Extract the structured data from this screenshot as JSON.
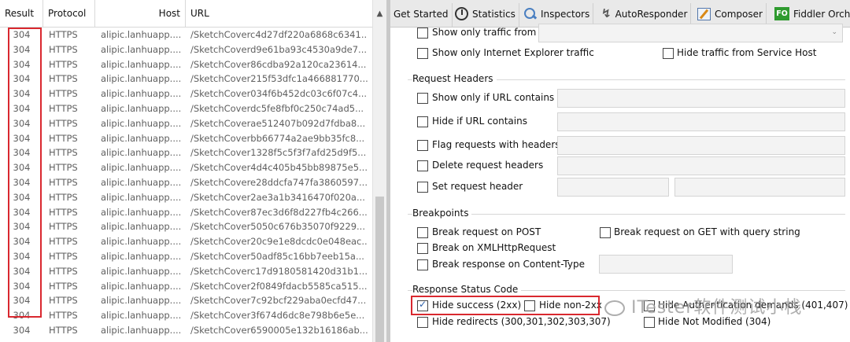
{
  "sessions": {
    "columns": {
      "result": "Result",
      "protocol": "Protocol",
      "host": "Host",
      "url": "URL"
    },
    "scroll_up_icon": "up-arrow",
    "rows": [
      {
        "result": "304",
        "protocol": "HTTPS",
        "host": "alipic.lanhuapp....",
        "url": "/SketchCoverc4d27df220a6868c6341..."
      },
      {
        "result": "304",
        "protocol": "HTTPS",
        "host": "alipic.lanhuapp....",
        "url": "/SketchCoverd9e61ba93c4530a9de7..."
      },
      {
        "result": "304",
        "protocol": "HTTPS",
        "host": "alipic.lanhuapp....",
        "url": "/SketchCover86cdba92a120ca23614..."
      },
      {
        "result": "304",
        "protocol": "HTTPS",
        "host": "alipic.lanhuapp....",
        "url": "/SketchCover215f53dfc1a466881770..."
      },
      {
        "result": "304",
        "protocol": "HTTPS",
        "host": "alipic.lanhuapp....",
        "url": "/SketchCover034f6b452dc03c6f07c4..."
      },
      {
        "result": "304",
        "protocol": "HTTPS",
        "host": "alipic.lanhuapp....",
        "url": "/SketchCoverdc5fe8fbf0c250c74ad5..."
      },
      {
        "result": "304",
        "protocol": "HTTPS",
        "host": "alipic.lanhuapp....",
        "url": "/SketchCoverae512407b092d7fdba8..."
      },
      {
        "result": "304",
        "protocol": "HTTPS",
        "host": "alipic.lanhuapp....",
        "url": "/SketchCoverbb66774a2ae9bb35fc8..."
      },
      {
        "result": "304",
        "protocol": "HTTPS",
        "host": "alipic.lanhuapp....",
        "url": "/SketchCover1328f5c5f3f7afd25d9f5..."
      },
      {
        "result": "304",
        "protocol": "HTTPS",
        "host": "alipic.lanhuapp....",
        "url": "/SketchCover4d4c405b45bb89875e5..."
      },
      {
        "result": "304",
        "protocol": "HTTPS",
        "host": "alipic.lanhuapp....",
        "url": "/SketchCovere28ddcfa747fa3860597..."
      },
      {
        "result": "304",
        "protocol": "HTTPS",
        "host": "alipic.lanhuapp....",
        "url": "/SketchCover2ae3a1b3416470f020a..."
      },
      {
        "result": "304",
        "protocol": "HTTPS",
        "host": "alipic.lanhuapp....",
        "url": "/SketchCover87ec3d6f8d227fb4c266..."
      },
      {
        "result": "304",
        "protocol": "HTTPS",
        "host": "alipic.lanhuapp....",
        "url": "/SketchCover5050c676b35070f9229..."
      },
      {
        "result": "304",
        "protocol": "HTTPS",
        "host": "alipic.lanhuapp....",
        "url": "/SketchCover20c9e1e8dcdc0e048eac..."
      },
      {
        "result": "304",
        "protocol": "HTTPS",
        "host": "alipic.lanhuapp....",
        "url": "/SketchCover50adf85c16bb7eeb15a..."
      },
      {
        "result": "304",
        "protocol": "HTTPS",
        "host": "alipic.lanhuapp....",
        "url": "/SketchCoverc17d9180581420d31b1..."
      },
      {
        "result": "304",
        "protocol": "HTTPS",
        "host": "alipic.lanhuapp....",
        "url": "/SketchCover2f0849fdacb5585ca515..."
      },
      {
        "result": "304",
        "protocol": "HTTPS",
        "host": "alipic.lanhuapp....",
        "url": "/SketchCover7c92bcf229aba0ecfd47..."
      },
      {
        "result": "304",
        "protocol": "HTTPS",
        "host": "alipic.lanhuapp....",
        "url": "/SketchCover3f674d6dc8e798b6e5e..."
      },
      {
        "result": "304",
        "protocol": "HTTPS",
        "host": "alipic.lanhuapp....",
        "url": "/SketchCover6590005e132b16186ab..."
      }
    ]
  },
  "tabs": [
    {
      "label": "Get Started",
      "icon": ""
    },
    {
      "label": "Statistics",
      "icon": "stopwatch-icon"
    },
    {
      "label": "Inspectors",
      "icon": "magnifier-icon"
    },
    {
      "label": "AutoResponder",
      "icon": "lightning-icon"
    },
    {
      "label": "Composer",
      "icon": "pencil-icon"
    },
    {
      "label": "Fiddler Orche",
      "icon": "fo-icon",
      "icon_text": "FO"
    }
  ],
  "filters": {
    "traffic": {
      "show_only_from": {
        "label": "Show only traffic from",
        "checked": false,
        "value": ""
      },
      "show_only_ie": {
        "label": "Show only Internet Explorer traffic",
        "checked": false
      },
      "hide_service_host": {
        "label": "Hide traffic from Service Host",
        "checked": false
      }
    },
    "request_headers": {
      "title": "Request Headers",
      "show_if_url": {
        "label": "Show only if URL contains",
        "checked": false,
        "value": ""
      },
      "hide_if_url": {
        "label": "Hide if URL contains",
        "checked": false,
        "value": ""
      },
      "flag_with_headers": {
        "label": "Flag requests with headers",
        "checked": false,
        "value": ""
      },
      "delete_headers": {
        "label": "Delete request headers",
        "checked": false,
        "value": ""
      },
      "set_header": {
        "label": "Set request header",
        "checked": false,
        "name": "",
        "value": ""
      }
    },
    "breakpoints": {
      "title": "Breakpoints",
      "break_post": {
        "label": "Break request on POST",
        "checked": false
      },
      "break_get_qs": {
        "label": "Break request on GET with query string",
        "checked": false
      },
      "break_xhr": {
        "label": "Break on XMLHttpRequest",
        "checked": false
      },
      "break_content_type": {
        "label": "Break response on Content-Type",
        "checked": false,
        "value": ""
      }
    },
    "response_status": {
      "title": "Response Status Code",
      "hide_success": {
        "label": "Hide success (2xx)",
        "checked": true
      },
      "hide_non2xx": {
        "label": "Hide non-2xx",
        "checked": false
      },
      "hide_auth": {
        "label": "Hide Authentication demands (401,407)",
        "checked": false
      },
      "hide_redirects": {
        "label": "Hide redirects (300,301,302,303,307)",
        "checked": false
      },
      "hide_not_modified": {
        "label": "Hide Not Modified (304)",
        "checked": false
      }
    }
  },
  "watermark": "ITester软件测试小栈",
  "colors": {
    "highlight": "#d9282f",
    "fo_icon": "#2f9b2f"
  }
}
